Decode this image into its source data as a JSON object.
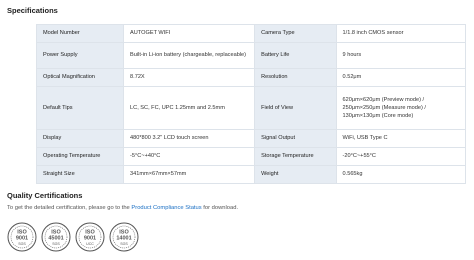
{
  "specifications": {
    "title": "Specifications",
    "rows": [
      {
        "l1": "Model Number",
        "v1": "AUTOGET WIFI",
        "l2": "Camera Type",
        "v2": "1/1.8 inch CMOS sensor"
      },
      {
        "l1": "Power Supply",
        "v1": "Built-in Li-ion battery  (chargeable, replaceable)",
        "l2": "Battery Life",
        "v2": "9 hours"
      },
      {
        "l1": "Optical Magnification",
        "v1": "8.72X",
        "l2": "Resolution",
        "v2": "0.52μm"
      },
      {
        "l1": "Default Tips",
        "v1": "LC, SC, FC, UPC 1.25mm and 2.5mm",
        "l2": "Field of View",
        "v2": "620μm×620μm (Preview mode) / 250μm×250μm (Measure mode) / 130μm×130μm (Core mode)"
      },
      {
        "l1": "Display",
        "v1": "480*800 3.2\" LCD touch screen",
        "l2": "Signal Output",
        "v2": "WiFi, USB Type C"
      },
      {
        "l1": "Operating Temperature",
        "v1": "-5°C~+40°C",
        "l2": "Storage Temperature",
        "v2": "-20°C~+55°C"
      },
      {
        "l1": "Straight Size",
        "v1": "341mm×67mm×57mm",
        "l2": "Weight",
        "v2": "0.565kg"
      }
    ]
  },
  "quality": {
    "title": "Quality Certifications",
    "text_before": "To get the detailed certification, please go to the ",
    "link": "Product Compliance Status",
    "text_after": " for download.",
    "badges": [
      {
        "top": "ISO",
        "num": "9001",
        "bottom": "SGS",
        "color": "#555555"
      },
      {
        "top": "ISO",
        "num": "45001",
        "bottom": "SGS",
        "color": "#555555"
      },
      {
        "top": "ISO",
        "num": "9001",
        "bottom": "UCC",
        "color": "#555555"
      },
      {
        "top": "ISO",
        "num": "14001",
        "bottom": "SGS",
        "color": "#555555"
      }
    ]
  }
}
